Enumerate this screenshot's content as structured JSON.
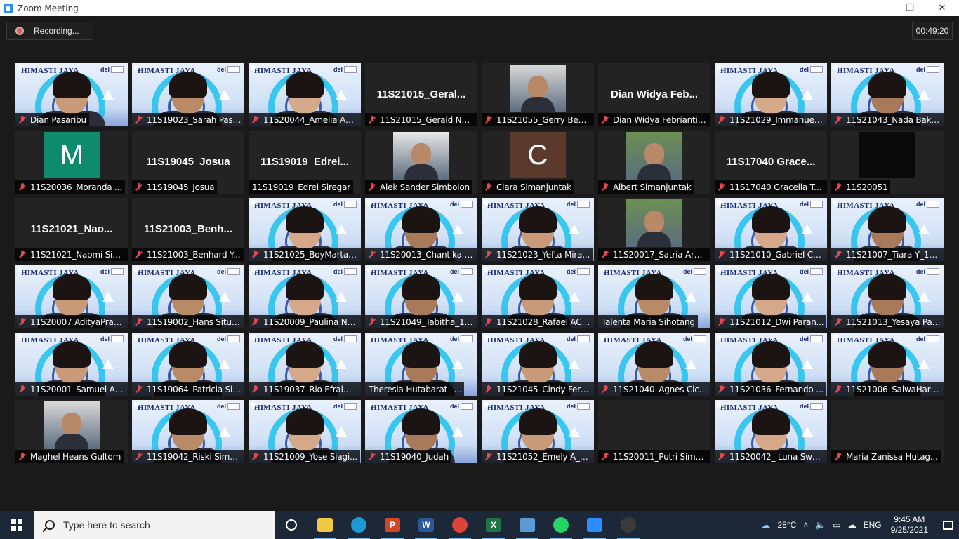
{
  "window": {
    "title": "Zoom Meeting",
    "minimize": "—",
    "restore": "❐",
    "close": "✕"
  },
  "meeting": {
    "recording_label": "Recording...",
    "timer": "00:49:20",
    "virtual_bg": {
      "title": "HIMASTI JAYA",
      "org": "del"
    },
    "tiles": [
      {
        "name": "Dian Pasaribu",
        "kind": "vbg",
        "muted": true,
        "self": true
      },
      {
        "name": "11S19023_Sarah Pasa...",
        "kind": "vbg",
        "muted": true
      },
      {
        "name": "11S20044_Amelia Ag...",
        "kind": "vbg",
        "muted": true
      },
      {
        "name": "11S21015_Gerald Nat...",
        "kind": "name",
        "big": "11S21015_Geral...",
        "muted": true
      },
      {
        "name": "11S21055_Gerry Beny...",
        "kind": "photo",
        "muted": true
      },
      {
        "name": "Dian Widya Febrianti ...",
        "kind": "name",
        "big": "Dian Widya Feb...",
        "muted": true
      },
      {
        "name": "11S21029_Immanuel ...",
        "kind": "vbg",
        "muted": true
      },
      {
        "name": "11S21043_Nada Baka...",
        "kind": "vbg",
        "muted": true
      },
      {
        "name": "11S20036_Moranda ...",
        "kind": "avatar",
        "letter": "M",
        "color": "#0e8a6d",
        "muted": true
      },
      {
        "name": "11S19045_Josua",
        "kind": "name",
        "big": "11S19045_Josua",
        "muted": true
      },
      {
        "name": "11S19019_Edrei Siregar",
        "kind": "name",
        "big": "11S19019_Edrei...",
        "muted": false
      },
      {
        "name": "Alek Sander Simbolon",
        "kind": "photo",
        "muted": true
      },
      {
        "name": "Clara Simanjuntak",
        "kind": "avatar",
        "letter": "C",
        "color": "#5b3a2c",
        "muted": true
      },
      {
        "name": "Albert Simanjuntak",
        "kind": "photo",
        "muted": true
      },
      {
        "name": "11S17040 Gracella Ta...",
        "kind": "name",
        "big": "11S17040 Grace...",
        "muted": true
      },
      {
        "name": "11S20051",
        "kind": "avatar",
        "letter": "",
        "color": "#0a0a0a",
        "muted": true
      },
      {
        "name": "11S21021_Naomi Sih...",
        "kind": "name",
        "big": "11S21021_Nao...",
        "muted": true
      },
      {
        "name": "11S21003_Benhard Y...",
        "kind": "name",
        "big": "11S21003_Benh...",
        "muted": true
      },
      {
        "name": "11S21025_BoyMartah...",
        "kind": "vbg",
        "muted": true
      },
      {
        "name": "11S20013_Chantika N...",
        "kind": "vbg",
        "muted": true
      },
      {
        "name": "11S21023_Yefta Mira...",
        "kind": "vbg",
        "muted": true
      },
      {
        "name": "11S20017_Satria Arm...",
        "kind": "photo",
        "muted": true
      },
      {
        "name": "11S21010_Gabriel Ce...",
        "kind": "vbg",
        "muted": true
      },
      {
        "name": "11S21007_Tiara Y_11I...",
        "kind": "vbg",
        "muted": true
      },
      {
        "name": "11S20007 AdityaPrata...",
        "kind": "vbg",
        "muted": true
      },
      {
        "name": "11S19002_Hans Situm...",
        "kind": "vbg",
        "muted": true
      },
      {
        "name": "11S20009_Paulina Na...",
        "kind": "vbg",
        "muted": true
      },
      {
        "name": "11S21049_Tabitha_11I...",
        "kind": "vbg",
        "muted": true
      },
      {
        "name": "11S21028_Rafael AC ...",
        "kind": "vbg",
        "muted": true
      },
      {
        "name": "Talenta Maria Sihotang",
        "kind": "vbg",
        "muted": false
      },
      {
        "name": "11S21012_Dwi Paran...",
        "kind": "vbg",
        "muted": true
      },
      {
        "name": "11S21013_Yesaya Par...",
        "kind": "vbg",
        "muted": true
      },
      {
        "name": "11S20001_Samuel Adi...",
        "kind": "vbg",
        "muted": true
      },
      {
        "name": "11S19064_Patricia Sib...",
        "kind": "vbg",
        "muted": true
      },
      {
        "name": "11S19037_Rio Efraim S",
        "kind": "vbg",
        "muted": true
      },
      {
        "name": "Theresia Hutabarat_ ...",
        "kind": "vbg",
        "muted": false
      },
      {
        "name": "11S21045_Cindy Fero...",
        "kind": "vbg",
        "muted": true
      },
      {
        "name": "11S21040_Agnes Cicil...",
        "kind": "vbg",
        "muted": true
      },
      {
        "name": "11S21036_Fernando ...",
        "kind": "vbg",
        "muted": true
      },
      {
        "name": "11S21006_SalwaHara...",
        "kind": "vbg",
        "muted": true
      },
      {
        "name": "Maghel Heans Gultom",
        "kind": "photo",
        "muted": true
      },
      {
        "name": "11S19042_Riski Siman...",
        "kind": "vbg",
        "muted": true
      },
      {
        "name": "11S21009_Yose Siagi...",
        "kind": "vbg",
        "muted": true
      },
      {
        "name": "11S19040_Judah",
        "kind": "vbg",
        "muted": true
      },
      {
        "name": "11S21052_Emely A_11...",
        "kind": "vbg",
        "muted": true
      },
      {
        "name": "11S20011_Putri Sima...",
        "kind": "blank",
        "muted": true
      },
      {
        "name": "11S20042_ Luna Swee...",
        "kind": "vbg",
        "muted": true
      },
      {
        "name": "Maria Zanissa Hutag...",
        "kind": "blank",
        "muted": true
      }
    ]
  },
  "taskbar": {
    "search_placeholder": "Type here to search",
    "apps": [
      {
        "name": "task-view",
        "label": "",
        "color": "#ffffff"
      },
      {
        "name": "file-explorer",
        "label": "",
        "color": "#f2c744"
      },
      {
        "name": "edge",
        "label": "",
        "color": "#1d9ad6"
      },
      {
        "name": "powerpoint",
        "label": "P",
        "color": "#d24726"
      },
      {
        "name": "word",
        "label": "W",
        "color": "#2b579a"
      },
      {
        "name": "chrome",
        "label": "",
        "color": "#db4437"
      },
      {
        "name": "excel",
        "label": "X",
        "color": "#217346"
      },
      {
        "name": "paint",
        "label": "",
        "color": "#5b9bd5"
      },
      {
        "name": "whatsapp",
        "label": "",
        "color": "#25d366"
      },
      {
        "name": "zoom",
        "label": "",
        "color": "#2d8cff"
      },
      {
        "name": "obs",
        "label": "",
        "color": "#3a3a3a"
      }
    ],
    "weather": "28°C",
    "language": "ENG",
    "time": "9:45 AM",
    "date": "9/25/2021"
  }
}
